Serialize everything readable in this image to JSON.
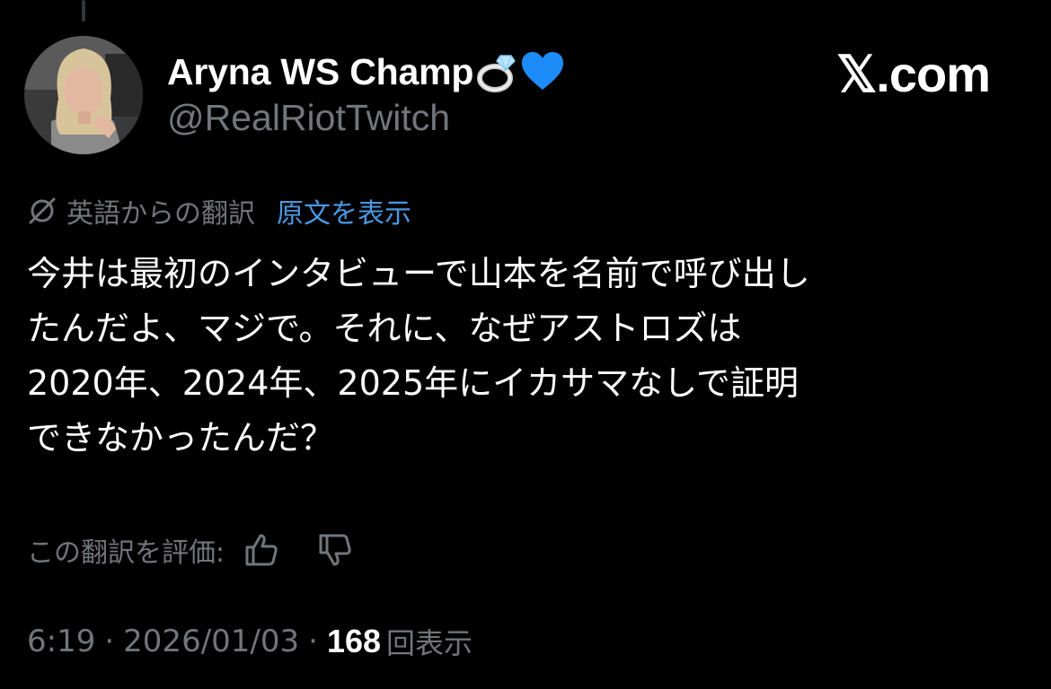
{
  "author": {
    "display_name": "Aryna WS Champ",
    "handle": "@RealRiotTwitch",
    "name_emojis": [
      "ring-emoji",
      "blue-heart-emoji"
    ]
  },
  "brand": {
    "label": "𝕏.com"
  },
  "translation": {
    "icon": "translate-icon",
    "translated_from": "英語からの翻訳",
    "show_original": "原文を表示"
  },
  "tweet": {
    "lines": [
      "今井は最初のインタビューで山本を名前で呼び出し",
      "たんだよ、マジで。それに、なぜアストロズは",
      "2020年、2024年、2025年にイカサマなしで証明",
      "できなかったんだ？"
    ]
  },
  "rating": {
    "label": "この翻訳を評価:",
    "icons": [
      "thumbs-up-icon",
      "thumbs-down-icon"
    ]
  },
  "meta": {
    "time": "6:19",
    "separator": "·",
    "date": "2026/01/03",
    "view_count": "168",
    "views_label": "回表示"
  },
  "colors": {
    "background": "#000000",
    "primary_text": "#ffffff",
    "secondary_text": "#71767b",
    "link": "#4a98e3",
    "heart": "#1d8cf8"
  }
}
